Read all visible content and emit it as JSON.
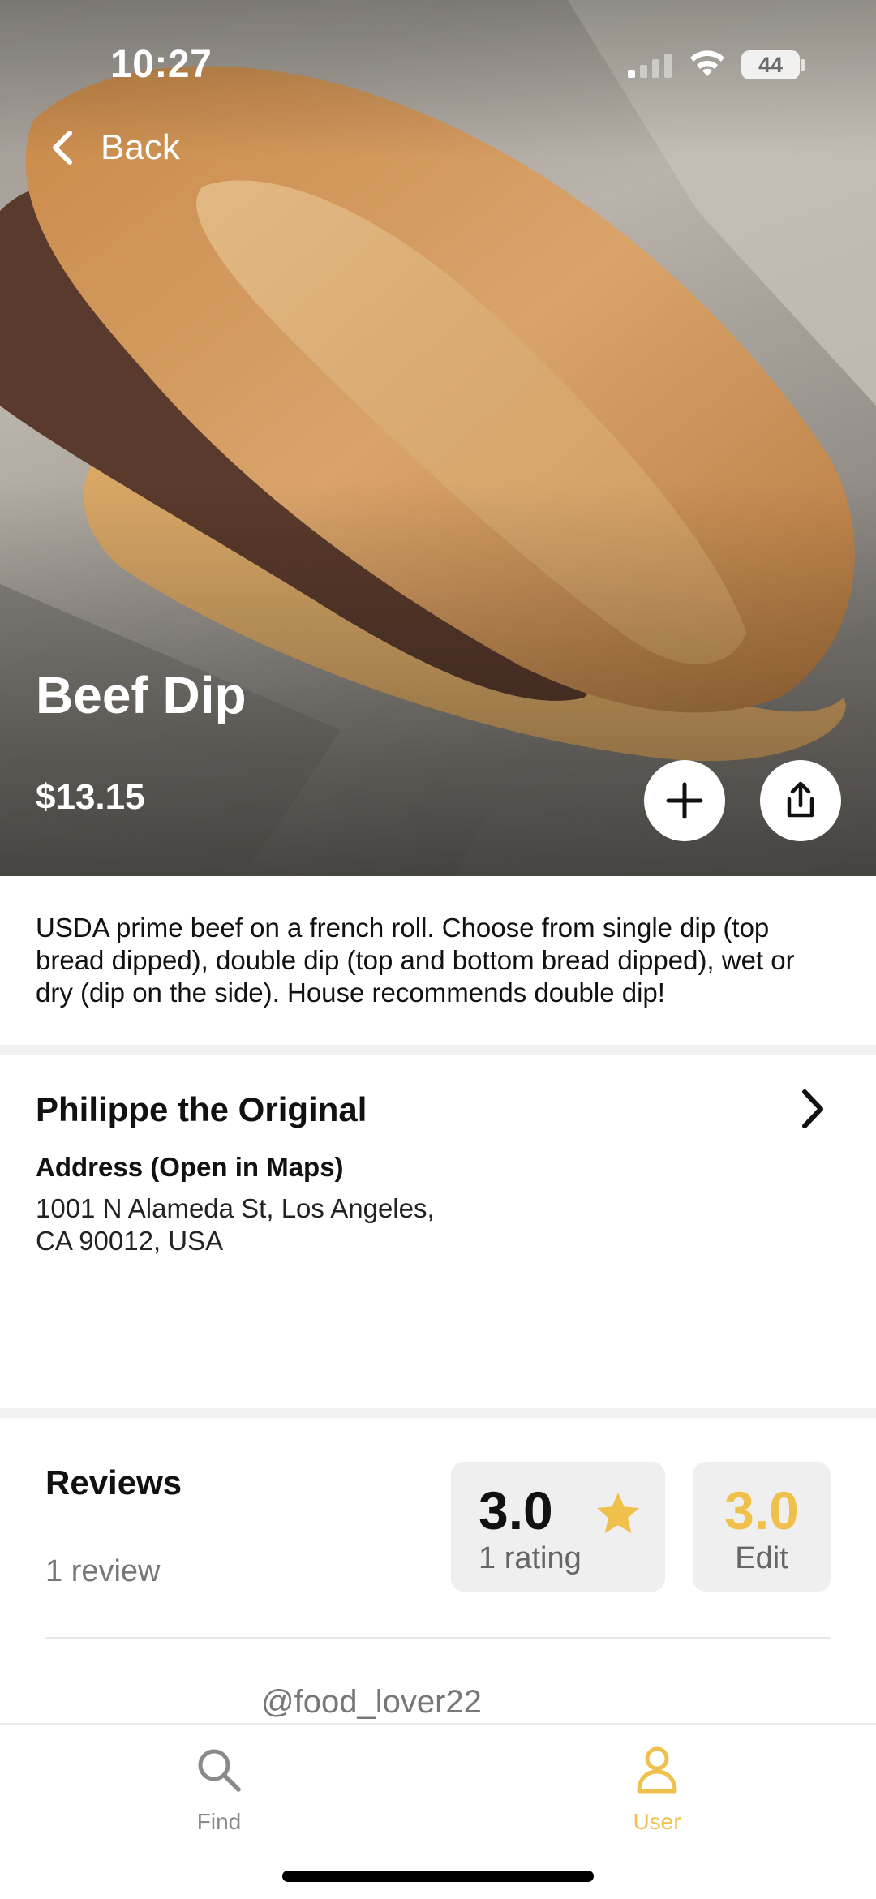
{
  "status_bar": {
    "time": "10:27",
    "battery": "44"
  },
  "nav": {
    "back_label": "Back"
  },
  "dish": {
    "title": "Beef Dip",
    "price": "$13.15",
    "description": "USDA prime beef on a french roll. Choose from single dip (top bread dipped), double dip (top and bottom bread dipped), wet or dry (dip on the side).  House recommends double dip!"
  },
  "restaurant": {
    "name": "Philippe the Original",
    "address_label": "Address (Open in Maps)",
    "address": "1001 N Alameda St, Los Angeles, CA 90012, USA"
  },
  "reviews": {
    "title": "Reviews",
    "count_label": "1 review",
    "average_rating": "3.0",
    "rating_count_label": "1 rating",
    "my_rating": "3.0",
    "edit_label": "Edit",
    "first_review_user": "@food_lover22"
  },
  "tab_bar": {
    "tabs": [
      {
        "label": "Find",
        "icon": "search-icon",
        "active": false
      },
      {
        "label": "User",
        "icon": "user-icon",
        "active": true
      }
    ]
  },
  "colors": {
    "accent": "#f0c04d",
    "muted_text": "#777777",
    "panel": "#efefef"
  }
}
